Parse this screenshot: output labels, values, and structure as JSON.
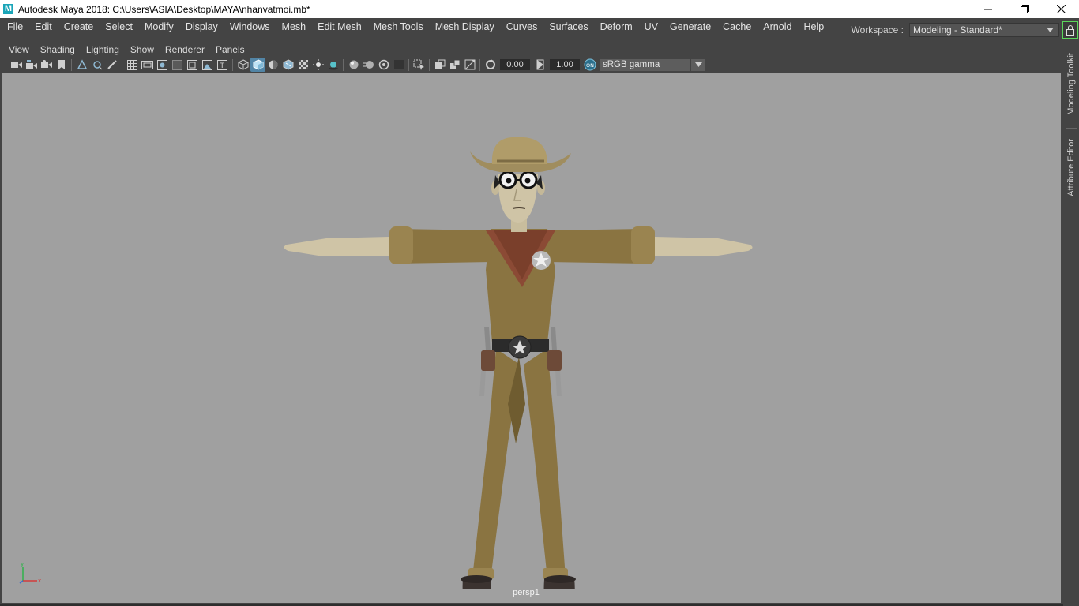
{
  "window": {
    "app_icon_letter": "M",
    "title": "Autodesk Maya 2018: C:\\Users\\ASIA\\Desktop\\MAYA\\nhanvatmoi.mb*",
    "controls": [
      "minimize-icon",
      "restore-icon",
      "close-icon"
    ]
  },
  "main_menu": {
    "items": [
      "File",
      "Edit",
      "Create",
      "Select",
      "Modify",
      "Display",
      "Windows",
      "Mesh",
      "Edit Mesh",
      "Mesh Tools",
      "Mesh Display",
      "Curves",
      "Surfaces",
      "Deform",
      "UV",
      "Generate",
      "Cache",
      "Arnold",
      "Help"
    ]
  },
  "workspace": {
    "label": "Workspace :",
    "value": "Modeling - Standard*"
  },
  "panel_menu": {
    "items": [
      "View",
      "Shading",
      "Lighting",
      "Show",
      "Renderer",
      "Panels"
    ]
  },
  "panel_toolbar": {
    "exposure": "0.00",
    "gamma": "1.00",
    "color_space": "sRGB gamma",
    "icons": [
      "select-camera-icon",
      "camera-attributes-icon",
      "bookmarks-icon",
      "image-plane-icon",
      "2d-pan-zoom-icon",
      "grease-pencil-icon",
      "grid-icon",
      "film-gate-icon",
      "resolution-gate-icon",
      "gate-mask-icon",
      "field-chart-icon",
      "safe-action-icon",
      "safe-title-icon",
      "wireframe-icon",
      "smooth-shade-icon",
      "wireframe-on-shaded-icon",
      "textured-icon",
      "use-all-lights-icon",
      "shadows-icon",
      "screen-space-ao-icon",
      "motion-blur-icon",
      "multisample-aa-icon",
      "depth-of-field-icon",
      "isolate-select-icon",
      "xray-icon",
      "xray-active-components-icon",
      "xray-joints-icon",
      "exposure-icon",
      "gamma-icon",
      "color-management-icon"
    ]
  },
  "viewport": {
    "camera": "persp1",
    "background_color": "#a0a0a0",
    "axis_labels": [
      "y",
      "x"
    ]
  },
  "side_tabs": [
    "Modeling Toolkit",
    "Attribute Editor"
  ],
  "colors": {
    "ui_background": "#444444",
    "active_icon": "#5285a6",
    "lock_border": "#5bd65b"
  }
}
